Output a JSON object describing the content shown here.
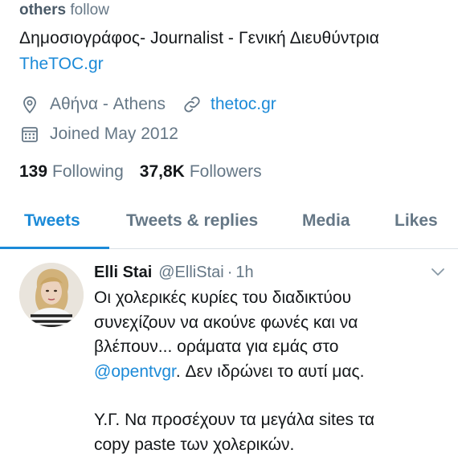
{
  "profile": {
    "followed_by_prefix": "others",
    "followed_by_suffix": "follow",
    "bio": "Δημοσιογράφος- Journalist - Γενική Διευθύντρια",
    "bio_link": "TheTOC.gr",
    "location": "Αθήνα - Athens",
    "website": "thetoc.gr",
    "joined": "Joined May 2012",
    "following_count": "139",
    "following_label": "Following",
    "followers_count": "37,8K",
    "followers_label": "Followers"
  },
  "tabs": [
    {
      "label": "Tweets",
      "active": true
    },
    {
      "label": "Tweets & replies",
      "active": false
    },
    {
      "label": "Media",
      "active": false
    },
    {
      "label": "Likes",
      "active": false
    }
  ],
  "tweet": {
    "author_name": "Elli Stai",
    "author_handle": "@ElliStai",
    "separator": "·",
    "time": "1h",
    "lines": [
      "Οι χολερικές κυρίες του διαδικτύου",
      "συνεχίζουν να ακούνε φωνές και να",
      "βλέπουν... οράματα για εμάς στο"
    ],
    "mention": "@opentvgr",
    "mention_tail": ". Δεν ιδρώνει το αυτί μας.",
    "ps_lines": [
      "Υ.Γ. Να προσέχουν τα μεγάλα sites τα",
      "copy paste των χολερικών."
    ]
  },
  "icons": {
    "location": "map-pin-icon",
    "link": "link-icon",
    "calendar": "calendar-icon",
    "chevron": "chevron-down-icon"
  },
  "colors": {
    "accent": "#1b8ad8",
    "secondary_text": "#657786",
    "primary_text": "#14171a"
  }
}
